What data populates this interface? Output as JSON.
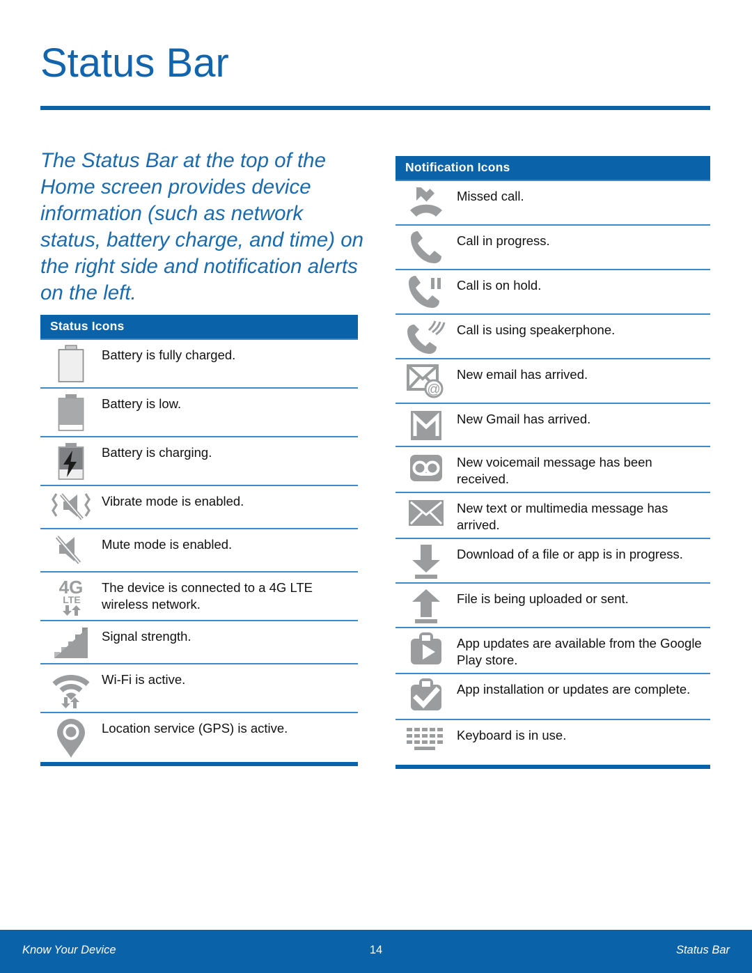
{
  "page": {
    "title": "Status Bar",
    "intro": "The Status Bar at the top of the Home screen provides device information (such as network status, battery charge, and time) on the right side and notification alerts on the left."
  },
  "colors": {
    "brand_blue": "#0a62a8",
    "title_blue": "#1265ad",
    "rule_blue": "#3b89cb",
    "icon_gray": "#9b9c9e",
    "text_black": "#111111"
  },
  "status_table": {
    "header": "Status Icons",
    "rows": [
      {
        "icon": "battery-full-icon",
        "text": "Battery is fully charged."
      },
      {
        "icon": "battery-low-icon",
        "text": "Battery is low."
      },
      {
        "icon": "battery-charging-icon",
        "text": "Battery is charging."
      },
      {
        "icon": "vibrate-icon",
        "text": "Vibrate mode is enabled."
      },
      {
        "icon": "mute-icon",
        "text": "Mute mode is enabled."
      },
      {
        "icon": "4g-lte-icon",
        "text": "The device is connected to a 4G LTE wireless network."
      },
      {
        "icon": "signal-strength-icon",
        "text": "Signal strength."
      },
      {
        "icon": "wifi-icon",
        "text": "Wi-Fi is active."
      },
      {
        "icon": "location-pin-icon",
        "text": "Location service (GPS) is active."
      }
    ],
    "icon_labels": {
      "lte_primary": "4G",
      "lte_secondary": "LTE"
    }
  },
  "notification_table": {
    "header": "Notification Icons",
    "rows": [
      {
        "icon": "missed-call-icon",
        "text": "Missed call."
      },
      {
        "icon": "call-in-progress-icon",
        "text": "Call in progress."
      },
      {
        "icon": "call-on-hold-icon",
        "text": "Call is on hold."
      },
      {
        "icon": "speakerphone-icon",
        "text": "Call is using speakerphone."
      },
      {
        "icon": "email-icon",
        "text": "New email has arrived."
      },
      {
        "icon": "gmail-icon",
        "text": "New Gmail has arrived."
      },
      {
        "icon": "voicemail-icon",
        "text": "New voicemail message has been received."
      },
      {
        "icon": "sms-mms-icon",
        "text": "New text or multimedia message has arrived."
      },
      {
        "icon": "download-icon",
        "text": "Download of a file or app is in progress."
      },
      {
        "icon": "upload-icon",
        "text": "File is being uploaded or sent."
      },
      {
        "icon": "play-store-update-icon",
        "text": "App updates are available from the Google Play store."
      },
      {
        "icon": "install-complete-icon",
        "text": "App installation or updates are complete."
      },
      {
        "icon": "keyboard-icon",
        "text": "Keyboard is in use."
      }
    ]
  },
  "footer": {
    "left": "Know Your Device",
    "page_number": "14",
    "right": "Status Bar"
  }
}
